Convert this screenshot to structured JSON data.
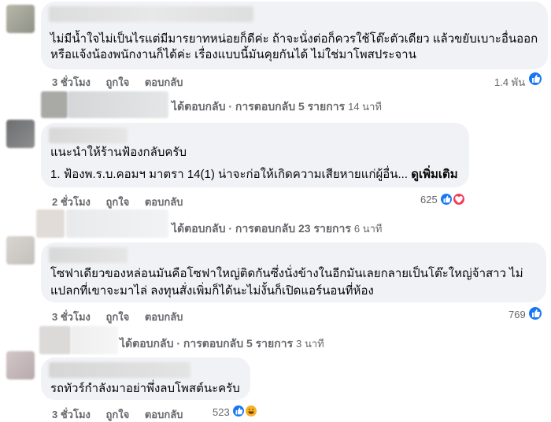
{
  "comments": [
    {
      "lines": [
        "ไม่มีน้ำใจไม่เป็นไรแต่มีมารยาทหน่อยก็ดีค่ะ ถ้าจะนั่งต่อก็ควรใช้โต๊ะตัวเดียว แล้วขยับเบาะอื่นออก",
        "หรือแจ้งน้องพนักงานก็ได้ค่ะ เรื่องแบบนี้มันคุยกันได้ ไม่ใช่มาโพสประจาน"
      ],
      "time": "3 ชั่วโมง",
      "like": "ถูกใจ",
      "reply": "ตอบกลับ",
      "reactions": "1.4 พัน",
      "replies_label": "ได้ตอบกลับ · การตอบกลับ 5 รายการ",
      "replies_time": "14 นาที"
    },
    {
      "lines": [
        "แนะนำให้ร้านฟ้องกลับครับ",
        "1. ฟ้องพ.ร.บ.คอมฯ มาตรา 14(1) น่าจะก่อให้เกิดความเสียหายแก่ผู้อื่น..."
      ],
      "see_more": "ดูเพิ่มเติม",
      "time": "2 ชั่วโมง",
      "like": "ถูกใจ",
      "reply": "ตอบกลับ",
      "reactions": "625",
      "replies_label": "ได้ตอบกลับ · การตอบกลับ 23 รายการ",
      "replies_time": "6 นาที"
    },
    {
      "lines": [
        "โซฟาเดียวของหล่อนมันคือโซฟาใหญ่ติดกันซึ่งนั่งข้างในอีกมันเลยกลายเป็นโต๊ะใหญ่จ้าสาว ไม่",
        "แปลกที่เขาจะมาไล่ ลงทุนสั่งเพิ่มก็ได้นะไม่งั้นก็เปิดแอร์นอนที่ห้อง"
      ],
      "time": "3 ชั่วโมง",
      "like": "ถูกใจ",
      "reply": "ตอบกลับ",
      "reactions": "769",
      "replies_label": "ได้ตอบกลับ · การตอบกลับ 5 รายการ",
      "replies_time": "3 นาที"
    },
    {
      "lines": [
        "รถทัวร์กำลังมาอย่าพึ่งลบโพสต์นะครับ"
      ],
      "time": "3 ชั่วโมง",
      "like": "ถูกใจ",
      "reply": "ตอบกลับ",
      "reactions": "523"
    }
  ],
  "colors": {
    "like_blue": "#1877f2",
    "love_red": "#f33e58",
    "haha_yellow": "#f7b125",
    "bubble": "#f0f2f5",
    "meta_gray": "#65676b"
  }
}
